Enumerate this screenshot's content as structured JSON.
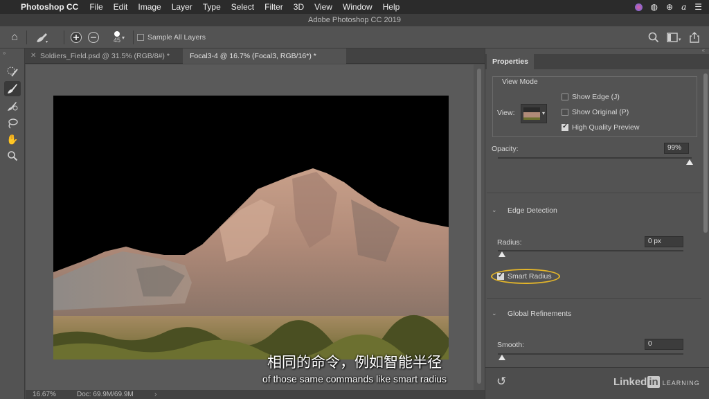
{
  "menubar": {
    "app_name": "Photoshop CC",
    "items": [
      "File",
      "Edit",
      "Image",
      "Layer",
      "Type",
      "Select",
      "Filter",
      "3D",
      "View",
      "Window",
      "Help"
    ]
  },
  "window_title": "Adobe Photoshop CC 2019",
  "options_bar": {
    "brush_size": "45",
    "sample_all_layers_label": "Sample All Layers",
    "sample_all_layers_checked": false
  },
  "tabs": [
    {
      "label": "Soldiers_Field.psd @ 31.5% (RGB/8#) *",
      "active": false
    },
    {
      "label": "Focal3-4 @ 16.7% (Focal3, RGB/16*) *",
      "active": true
    }
  ],
  "status": {
    "zoom": "16.67%",
    "doc": "Doc: 69.9M/69.9M"
  },
  "properties": {
    "tab_label": "Properties",
    "view_mode": {
      "title": "View Mode",
      "view_label": "View:",
      "show_edge_label": "Show Edge (J)",
      "show_edge_checked": false,
      "show_original_label": "Show Original (P)",
      "show_original_checked": false,
      "hq_preview_label": "High Quality Preview",
      "hq_preview_checked": true
    },
    "opacity": {
      "label": "Opacity:",
      "value": "99%",
      "level": 0.99
    },
    "edge_detection": {
      "title": "Edge Detection",
      "radius_label": "Radius:",
      "radius_value": "0 px",
      "smart_radius_label": "Smart Radius",
      "smart_radius_checked": true
    },
    "global_refinements": {
      "title": "Global Refinements",
      "smooth_label": "Smooth:",
      "smooth_value": "0"
    }
  },
  "subtitles": {
    "zh": "相同的命令，例如智能半径",
    "en": "of those same commands like smart radius"
  },
  "watermark": {
    "brand": "Linked",
    "badge": "in",
    "suffix": "LEARNING"
  },
  "colors": {
    "highlight": "#e3b52a",
    "panel_bg": "#535353"
  }
}
